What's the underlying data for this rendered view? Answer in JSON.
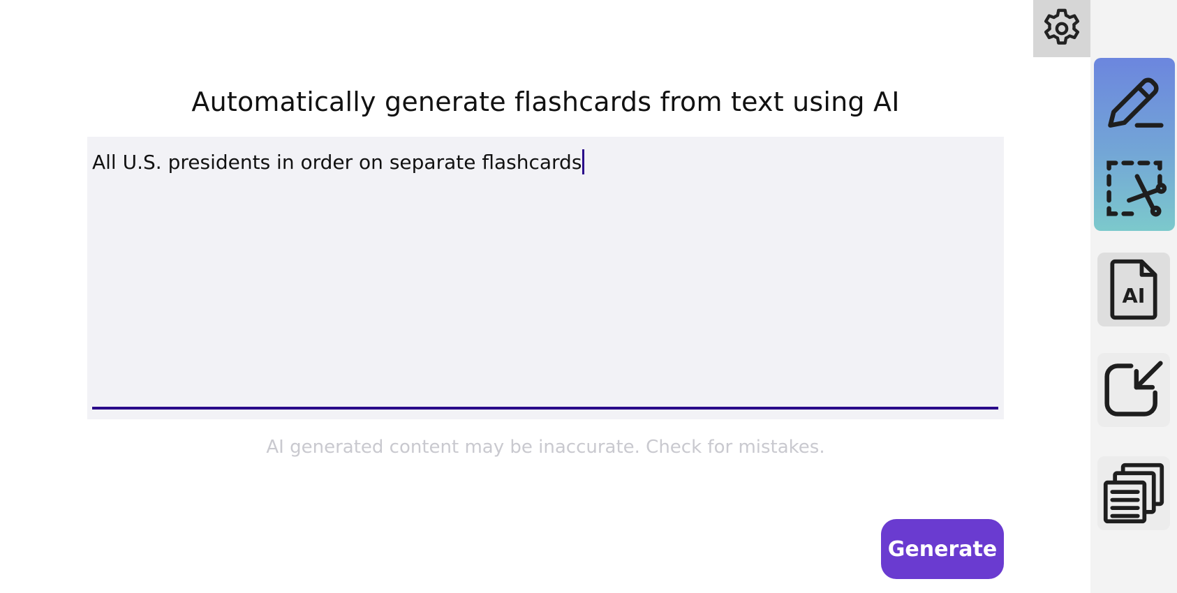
{
  "header": {
    "title": "Automatically generate flashcards from text using AI"
  },
  "editor": {
    "value": "All U.S. presidents in order on separate flashcards"
  },
  "disclaimer": {
    "text": "AI generated content may be inaccurate. Check for mistakes."
  },
  "actions": {
    "generate_label": "Generate"
  },
  "sidebar": {
    "tools": [
      {
        "icon": "pen-icon",
        "active": true
      },
      {
        "icon": "crop-scissors-icon",
        "active": true
      },
      {
        "icon": "ai-document-icon",
        "label": "AI",
        "active": false
      },
      {
        "icon": "import-arrow-icon",
        "active": false
      },
      {
        "icon": "stacked-cards-icon",
        "active": false
      }
    ]
  },
  "settings": {
    "icon": "gear-icon"
  },
  "colors": {
    "accent": "#6a3bd0",
    "underline": "#2a0a8a",
    "editor_bg": "#f2f2f6",
    "tool_gradient_top": "#6c86de",
    "tool_gradient_bottom": "#7cc9cc"
  }
}
